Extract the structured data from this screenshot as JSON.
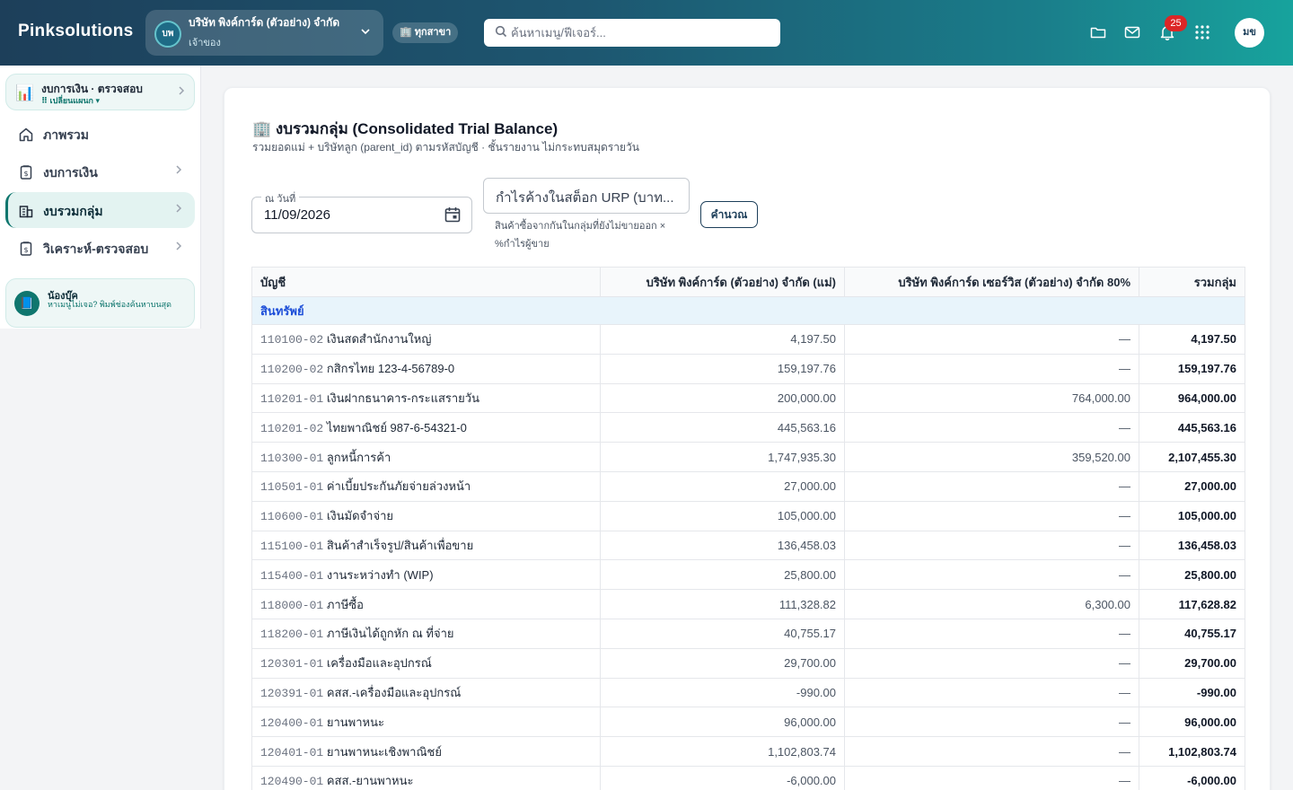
{
  "app": {
    "brand": "Pinksolutions"
  },
  "company": {
    "initials": "บพ",
    "name": "บริษัท พิงค์การ์ด (ตัวอย่าง) จำกัด",
    "role": "เจ้าของ"
  },
  "branch": {
    "label": "🏢 ทุกสาขา"
  },
  "search": {
    "placeholder": "ค้นหาเมนู/ฟีเจอร์..."
  },
  "notifications": {
    "count": "25"
  },
  "user": {
    "initials": "มข"
  },
  "sidebar": {
    "module": {
      "icon": "📊",
      "title": "งบการเงิน · ตรวจสอบ",
      "switch_label": "⠿ เปลี่ยนแผนก ▾"
    },
    "items": [
      {
        "label": "ภาพรวม",
        "icon": "home-icon"
      },
      {
        "label": "งบการเงิน",
        "icon": "document-icon"
      },
      {
        "label": "งบรวมกลุ่ม",
        "icon": "building-icon"
      },
      {
        "label": "วิเคราะห์-ตรวจสอบ",
        "icon": "document-icon"
      }
    ],
    "helper": {
      "icon": "📘",
      "title": "น้องบุ๊ค",
      "text": "หาเมนูไม่เจอ? พิมพ์ช่องค้นหาบนสุด"
    }
  },
  "main": {
    "title": "🏢 งบรวมกลุ่ม (Consolidated Trial Balance)",
    "subtitle": "รวมยอดแม่ + บริษัทลูก (parent_id) ตามรหัสบัญชี · ชั้นรายงาน ไม่กระทบสมุดรายวัน",
    "date_label": "ณ วันที่",
    "date_value": "11/09/2026",
    "urp_placeholder": "กำไรค้างในสต็อก URP (บาท...",
    "urp_help": "สินค้าซื้อจากกันในกลุ่มที่ยังไม่ขายออก × %กำไรผู้ขาย",
    "calc_label": "คำนวณ"
  },
  "table": {
    "headers": [
      "บัญชี",
      "บริษัท พิงค์การ์ด (ตัวอย่าง) จำกัด (แม่)",
      "บริษัท พิงค์การ์ด เซอร์วิส (ตัวอย่าง) จำกัด 80%",
      "รวมกลุ่ม"
    ],
    "section": "สินทรัพย์",
    "rows": [
      {
        "code": "110100-02",
        "name": "เงินสดสำนักงานใหญ่",
        "parent": "4,197.50",
        "sub": "—",
        "total": "4,197.50"
      },
      {
        "code": "110200-02",
        "name": "กสิกรไทย 123-4-56789-0",
        "parent": "159,197.76",
        "sub": "—",
        "total": "159,197.76"
      },
      {
        "code": "110201-01",
        "name": "เงินฝากธนาคาร-กระแสรายวัน",
        "parent": "200,000.00",
        "sub": "764,000.00",
        "total": "964,000.00"
      },
      {
        "code": "110201-02",
        "name": "ไทยพาณิชย์ 987-6-54321-0",
        "parent": "445,563.16",
        "sub": "—",
        "total": "445,563.16"
      },
      {
        "code": "110300-01",
        "name": "ลูกหนี้การค้า",
        "parent": "1,747,935.30",
        "sub": "359,520.00",
        "total": "2,107,455.30"
      },
      {
        "code": "110501-01",
        "name": "ค่าเบี้ยประกันภัยจ่ายล่วงหน้า",
        "parent": "27,000.00",
        "sub": "—",
        "total": "27,000.00"
      },
      {
        "code": "110600-01",
        "name": "เงินมัดจำจ่าย",
        "parent": "105,000.00",
        "sub": "—",
        "total": "105,000.00"
      },
      {
        "code": "115100-01",
        "name": "สินค้าสำเร็จรูป/สินค้าเพื่อขาย",
        "parent": "136,458.03",
        "sub": "—",
        "total": "136,458.03"
      },
      {
        "code": "115400-01",
        "name": "งานระหว่างทำ (WIP)",
        "parent": "25,800.00",
        "sub": "—",
        "total": "25,800.00"
      },
      {
        "code": "118000-01",
        "name": "ภาษีซื้อ",
        "parent": "111,328.82",
        "sub": "6,300.00",
        "total": "117,628.82"
      },
      {
        "code": "118200-01",
        "name": "ภาษีเงินได้ถูกหัก ณ ที่จ่าย",
        "parent": "40,755.17",
        "sub": "—",
        "total": "40,755.17"
      },
      {
        "code": "120301-01",
        "name": "เครื่องมือและอุปกรณ์",
        "parent": "29,700.00",
        "sub": "—",
        "total": "29,700.00"
      },
      {
        "code": "120391-01",
        "name": "คสส.-เครื่องมือและอุปกรณ์",
        "parent": "-990.00",
        "sub": "—",
        "total": "-990.00"
      },
      {
        "code": "120400-01",
        "name": "ยานพาหนะ",
        "parent": "96,000.00",
        "sub": "—",
        "total": "96,000.00"
      },
      {
        "code": "120401-01",
        "name": "ยานพาหนะเชิงพาณิชย์",
        "parent": "1,102,803.74",
        "sub": "—",
        "total": "1,102,803.74"
      },
      {
        "code": "120490-01",
        "name": "คสส.-ยานพาหนะ",
        "parent": "-6,000.00",
        "sub": "—",
        "total": "-6,000.00"
      }
    ]
  }
}
